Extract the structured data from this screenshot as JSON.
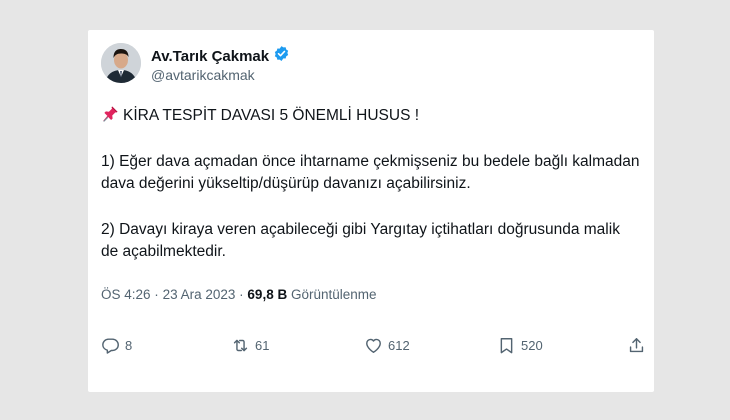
{
  "author": {
    "name": "Av.Tarık Çakmak",
    "handle": "@avtarikcakmak",
    "verified": true
  },
  "tweet": {
    "title": "KİRA TESPİT DAVASI 5 ÖNEMLİ HUSUS !",
    "paragraph1": "1) Eğer dava açmadan önce ihtarname çekmişseniz bu bedele bağlı kalmadan dava değerini yükseltip/düşürüp davanızı açabilirsiniz.",
    "paragraph2": "2) Davayı kiraya veren açabileceği gibi Yargıtay içtihatları doğrusunda malik de açabilmektedir."
  },
  "meta": {
    "time": "ÖS 4:26",
    "separator": "·",
    "date": "23 Ara 2023",
    "views_count": "69,8 B",
    "views_label": "Görüntülenme"
  },
  "actions": {
    "replies": "8",
    "retweets": "61",
    "likes": "612",
    "bookmarks": "520"
  },
  "colors": {
    "verified": "#1d9bf0",
    "text": "#0f1419",
    "muted": "#536471"
  }
}
